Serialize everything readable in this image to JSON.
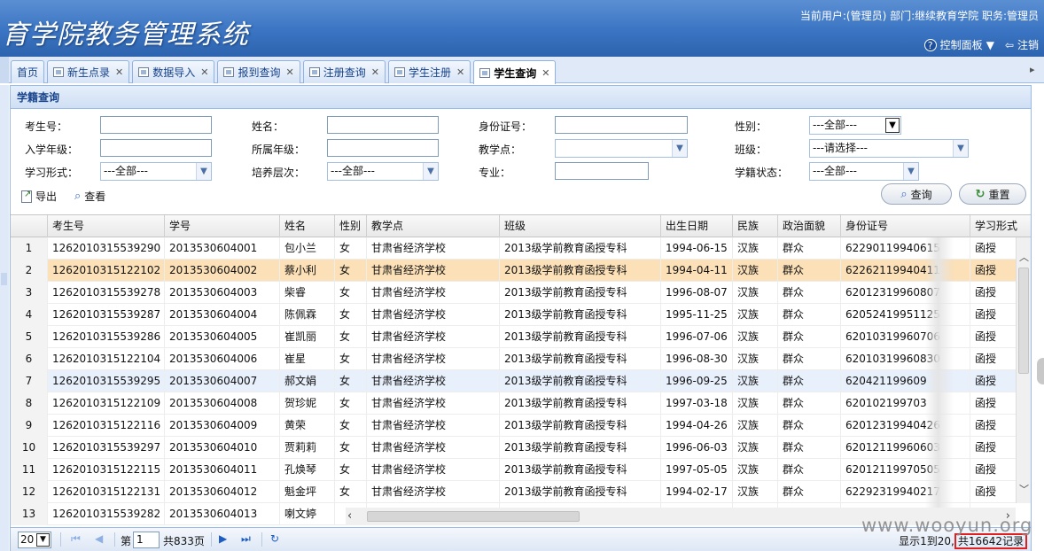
{
  "header": {
    "title": "育学院教务管理系统",
    "user_info": "当前用户:(管理员) 部门:继续教育学院 职务:管理员",
    "control_panel": "控制面板",
    "logout": "注销"
  },
  "tabs": [
    {
      "label": "首页"
    },
    {
      "label": "新生点录"
    },
    {
      "label": "数据导入"
    },
    {
      "label": "报到查询"
    },
    {
      "label": "注册查询"
    },
    {
      "label": "学生注册"
    },
    {
      "label": "学生查询"
    }
  ],
  "panel": {
    "title": "学籍查询"
  },
  "form": {
    "exam_no": "考生号：",
    "name": "姓名：",
    "id_no": "身份证号：",
    "gender": "性别：",
    "gender_value": "---全部---",
    "enroll_year": "入学年级：",
    "grade": "所属年级：",
    "site": "教学点：",
    "class": "班级：",
    "class_value": "---请选择---",
    "study_form": "学习形式：",
    "study_form_value": "---全部---",
    "level": "培养层次：",
    "level_value": "---全部---",
    "major": "专业：",
    "status": "学籍状态：",
    "status_value": "---全部---",
    "export": "导出",
    "view": "查看",
    "query": "查询",
    "reset": "重置"
  },
  "grid": {
    "columns": [
      "考生号",
      "学号",
      "姓名",
      "性别",
      "教学点",
      "班级",
      "出生日期",
      "民族",
      "政治面貌",
      "身份证号",
      "学习形式"
    ],
    "rows": [
      {
        "n": "1",
        "exam": "1262010315539290",
        "sid": "2013530604001",
        "name": "包小兰",
        "sex": "女",
        "site": "甘肃省经济学校",
        "cls": "2013级学前教育函授专科",
        "birth": "1994-06-15",
        "eth": "汉族",
        "pol": "群众",
        "idno": "62290119940615",
        "form": "函授"
      },
      {
        "n": "2",
        "exam": "1262010315122102",
        "sid": "2013530604002",
        "name": "蔡小利",
        "sex": "女",
        "site": "甘肃省经济学校",
        "cls": "2013级学前教育函授专科",
        "birth": "1994-04-11",
        "eth": "汉族",
        "pol": "群众",
        "idno": "62262119940411",
        "form": "函授"
      },
      {
        "n": "3",
        "exam": "1262010315539278",
        "sid": "2013530604003",
        "name": "柴睿",
        "sex": "女",
        "site": "甘肃省经济学校",
        "cls": "2013级学前教育函授专科",
        "birth": "1996-08-07",
        "eth": "汉族",
        "pol": "群众",
        "idno": "62012319960807",
        "form": "函授"
      },
      {
        "n": "4",
        "exam": "1262010315539287",
        "sid": "2013530604004",
        "name": "陈佩霖",
        "sex": "女",
        "site": "甘肃省经济学校",
        "cls": "2013级学前教育函授专科",
        "birth": "1995-11-25",
        "eth": "汉族",
        "pol": "群众",
        "idno": "62052419951125",
        "form": "函授"
      },
      {
        "n": "5",
        "exam": "1262010315539286",
        "sid": "2013530604005",
        "name": "崔凯丽",
        "sex": "女",
        "site": "甘肃省经济学校",
        "cls": "2013级学前教育函授专科",
        "birth": "1996-07-06",
        "eth": "汉族",
        "pol": "群众",
        "idno": "62010319960706",
        "form": "函授"
      },
      {
        "n": "6",
        "exam": "1262010315122104",
        "sid": "2013530604006",
        "name": "崔星",
        "sex": "女",
        "site": "甘肃省经济学校",
        "cls": "2013级学前教育函授专科",
        "birth": "1996-08-30",
        "eth": "汉族",
        "pol": "群众",
        "idno": "62010319960830",
        "form": "函授"
      },
      {
        "n": "7",
        "exam": "1262010315539295",
        "sid": "2013530604007",
        "name": "郝文娟",
        "sex": "女",
        "site": "甘肃省经济学校",
        "cls": "2013级学前教育函授专科",
        "birth": "1996-09-25",
        "eth": "汉族",
        "pol": "群众",
        "idno": "620421199609",
        "form": "函授"
      },
      {
        "n": "8",
        "exam": "1262010315122109",
        "sid": "2013530604008",
        "name": "贺珍妮",
        "sex": "女",
        "site": "甘肃省经济学校",
        "cls": "2013级学前教育函授专科",
        "birth": "1997-03-18",
        "eth": "汉族",
        "pol": "群众",
        "idno": "620102199703",
        "form": "函授"
      },
      {
        "n": "9",
        "exam": "1262010315122116",
        "sid": "2013530604009",
        "name": "黄荣",
        "sex": "女",
        "site": "甘肃省经济学校",
        "cls": "2013级学前教育函授专科",
        "birth": "1994-04-26",
        "eth": "汉族",
        "pol": "群众",
        "idno": "62012319940426",
        "form": "函授"
      },
      {
        "n": "10",
        "exam": "1262010315539297",
        "sid": "2013530604010",
        "name": "贾莉莉",
        "sex": "女",
        "site": "甘肃省经济学校",
        "cls": "2013级学前教育函授专科",
        "birth": "1996-06-03",
        "eth": "汉族",
        "pol": "群众",
        "idno": "62012119960603",
        "form": "函授"
      },
      {
        "n": "11",
        "exam": "1262010315122115",
        "sid": "2013530604011",
        "name": "孔焕琴",
        "sex": "女",
        "site": "甘肃省经济学校",
        "cls": "2013级学前教育函授专科",
        "birth": "1997-05-05",
        "eth": "汉族",
        "pol": "群众",
        "idno": "62012119970505",
        "form": "函授"
      },
      {
        "n": "12",
        "exam": "1262010315122131",
        "sid": "2013530604012",
        "name": "魁金坪",
        "sex": "女",
        "site": "甘肃省经济学校",
        "cls": "2013级学前教育函授专科",
        "birth": "1994-02-17",
        "eth": "汉族",
        "pol": "群众",
        "idno": "62292319940217",
        "form": "函授"
      },
      {
        "n": "13",
        "exam": "1262010315539282",
        "sid": "2013530604013",
        "name": "喇文婷",
        "sex": "",
        "site": "",
        "cls": "",
        "birth": "",
        "eth": "",
        "pol": "",
        "idno": "",
        "form": ""
      }
    ]
  },
  "pager": {
    "page_size": "20",
    "page_prefix": "第",
    "page_no": "1",
    "page_total": "共833页",
    "info_prefix": "显示1到20,",
    "info_total": "共16642记录"
  },
  "watermark": "www.wooyun.org"
}
